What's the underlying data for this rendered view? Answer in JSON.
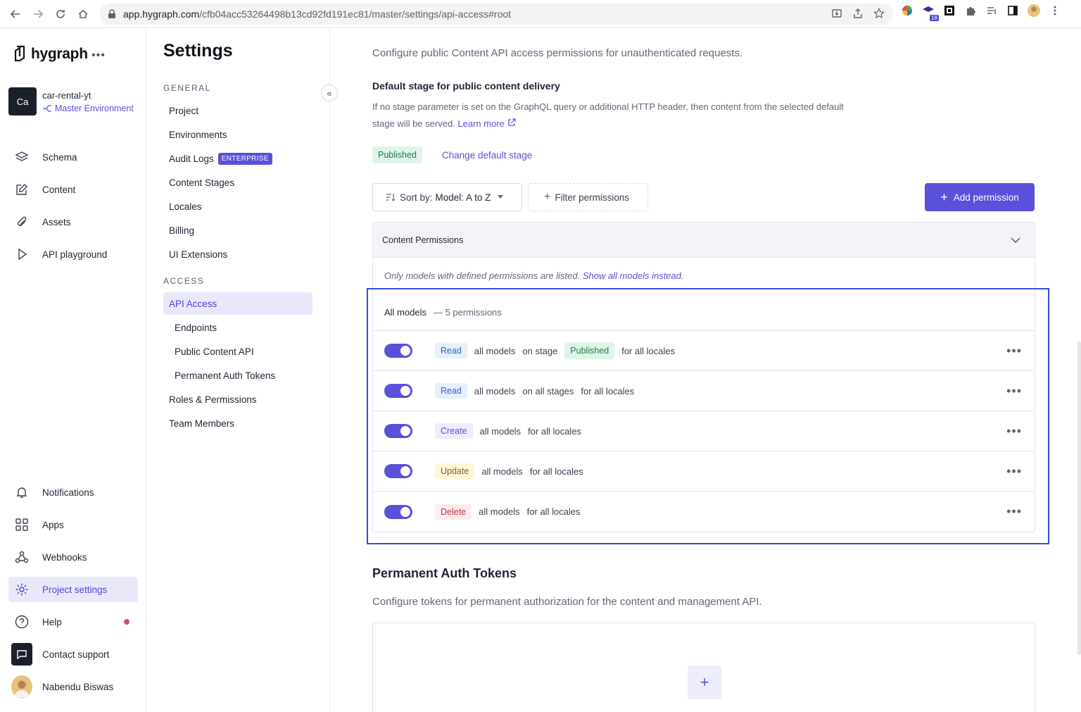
{
  "browser": {
    "url_host": "app.hygraph.com",
    "url_path": "/cfb04acc53264498b13cd92fd191ec81/master/settings/api-access#root",
    "ext_badge": "18"
  },
  "sidebar": {
    "logo": "hygraph",
    "more": "•••",
    "project_initials": "Ca",
    "project_name": "car-rental-yt",
    "environment": "Master Environment",
    "nav": [
      {
        "label": "Schema",
        "icon": "layers-icon"
      },
      {
        "label": "Content",
        "icon": "edit-icon"
      },
      {
        "label": "Assets",
        "icon": "paperclip-icon"
      },
      {
        "label": "API playground",
        "icon": "play-icon"
      }
    ],
    "bottom": [
      {
        "label": "Notifications",
        "icon": "bell-icon"
      },
      {
        "label": "Apps",
        "icon": "apps-icon"
      },
      {
        "label": "Webhooks",
        "icon": "webhook-icon"
      },
      {
        "label": "Project settings",
        "icon": "gear-icon"
      },
      {
        "label": "Help",
        "icon": "help-icon"
      },
      {
        "label": "Contact support",
        "icon": "chat-icon"
      },
      {
        "label": "Nabendu Biswas",
        "icon": "user-avatar"
      }
    ]
  },
  "settings": {
    "title": "Settings",
    "general_label": "GENERAL",
    "access_label": "ACCESS",
    "general": [
      "Project",
      "Environments",
      "Audit Logs",
      "Content Stages",
      "Locales",
      "Billing",
      "UI Extensions"
    ],
    "enterprise_badge": "ENTERPRISE",
    "access": [
      {
        "label": "API Access",
        "active": true
      },
      {
        "label": "Endpoints",
        "sub": true
      },
      {
        "label": "Public Content API",
        "sub": true
      },
      {
        "label": "Permanent Auth Tokens",
        "sub": true
      },
      {
        "label": "Roles & Permissions"
      },
      {
        "label": "Team Members"
      }
    ]
  },
  "main": {
    "public_api_desc": "Configure public Content API access permissions for unauthenticated requests.",
    "default_stage_title": "Default stage for public content delivery",
    "default_stage_desc": "If no stage parameter is set on the GraphQL query or additional HTTP header, then content from the selected default stage will be served.",
    "learn_more": "Learn more",
    "stage": "Published",
    "change_stage": "Change default stage",
    "sort_prefix": "Sort by:",
    "sort_value": "Model: A to Z",
    "filter": "Filter permissions",
    "add_permission": "Add permission",
    "card_title": "Content Permissions",
    "note_prefix": "Only models with defined permissions are listed.",
    "note_link": "Show all models instead.",
    "group_label": "All models",
    "group_count": "— 5 permissions",
    "rows": [
      {
        "action": "Read",
        "kind": "read",
        "parts": [
          "all models",
          "on stage"
        ],
        "stage": "Published",
        "tail": "for all locales",
        "enabled": true
      },
      {
        "action": "Read",
        "kind": "read",
        "parts": [
          "all models",
          "on all stages",
          "for all locales"
        ],
        "enabled": true
      },
      {
        "action": "Create",
        "kind": "create",
        "parts": [
          "all models",
          "for all locales"
        ],
        "enabled": true
      },
      {
        "action": "Update",
        "kind": "update",
        "parts": [
          "all models",
          "for all locales"
        ],
        "enabled": true
      },
      {
        "action": "Delete",
        "kind": "delete",
        "parts": [
          "all models",
          "for all locales"
        ],
        "enabled": true
      }
    ],
    "tokens_title": "Permanent Auth Tokens",
    "tokens_desc": "Configure tokens for permanent authorization for the content and management API."
  },
  "colors": {
    "accent": "#5a50d9",
    "highlight": "#2f4fd6"
  }
}
